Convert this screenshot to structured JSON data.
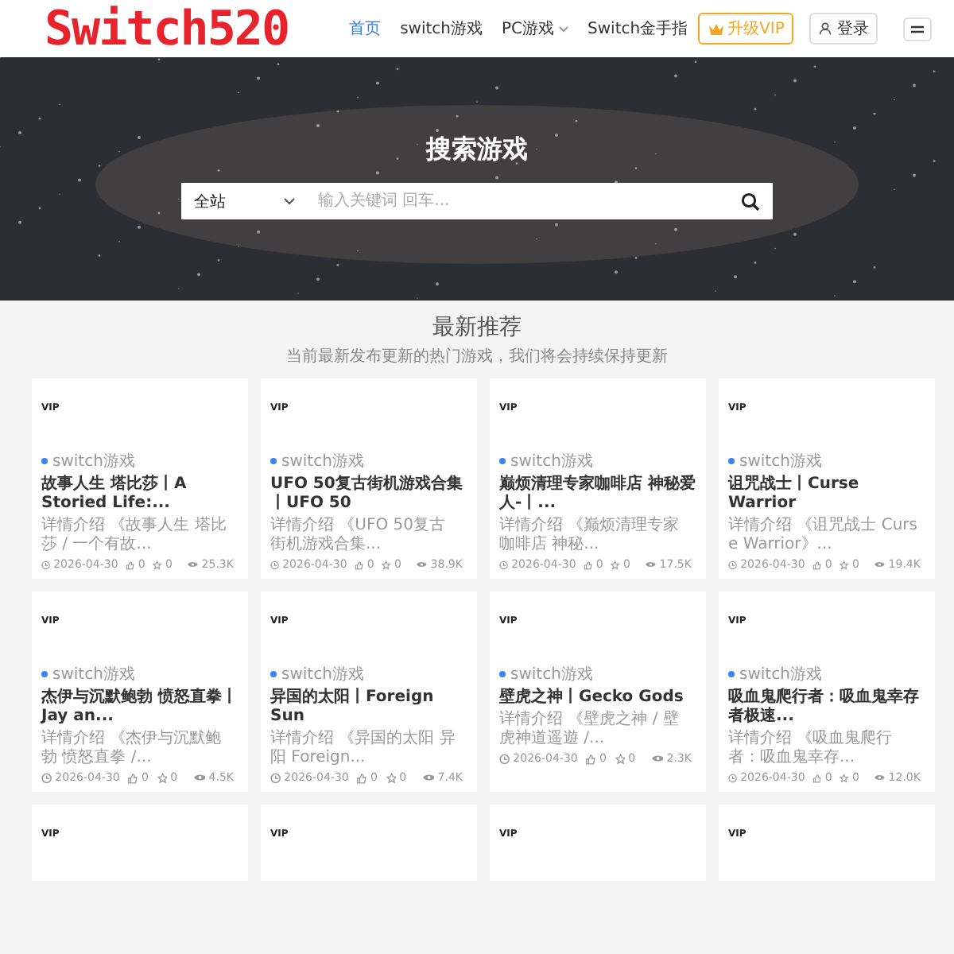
{
  "header": {
    "logo": "Switch520",
    "nav": [
      {
        "label": "首页",
        "selected": true,
        "dropdown": false
      },
      {
        "label": "switch游戏",
        "selected": false,
        "dropdown": false
      },
      {
        "label": "PC游戏",
        "selected": false,
        "dropdown": true
      },
      {
        "label": "Switch金手指",
        "selected": false,
        "dropdown": false
      }
    ],
    "vip_button": "升级VIP",
    "login_button": "登录"
  },
  "hero": {
    "title": "搜索游戏",
    "scope": "全站",
    "placeholder": "输入关键词 回车..."
  },
  "section": {
    "title": "最新推荐",
    "subtitle": "当前最新发布更新的热门游戏，我们将会持续保持更新"
  },
  "cards": [
    {
      "kind": "full",
      "badge": "VIP",
      "category": "switch游戏",
      "title": "故事人生 塔比莎丨A Storied Life:...",
      "description": "详情介绍 《故事人生 塔比莎 / 一个有故...",
      "date": "2026-04-30",
      "likes": "0",
      "favorites": "0",
      "views": "25.3K"
    },
    {
      "kind": "full",
      "badge": "VIP",
      "category": "switch游戏",
      "title": "UFO 50复古街机游戏合集丨UFO 50",
      "description": "详情介绍 《UFO 50复古街机游戏合集...",
      "date": "2026-04-30",
      "likes": "0",
      "favorites": "0",
      "views": "38.9K"
    },
    {
      "kind": "full",
      "badge": "VIP",
      "category": "switch游戏",
      "title": "巅烦清理专家咖啡店 神秘爱人-丨...",
      "description": "详情介绍 《巅烦清理专家咖啡店 神秘...",
      "date": "2026-04-30",
      "likes": "0",
      "favorites": "0",
      "views": "17.5K"
    },
    {
      "kind": "full",
      "badge": "VIP",
      "category": "switch游戏",
      "title": "诅咒战士丨Curse Warrior",
      "description": "详情介绍 《诅咒战士 Curse Warrior》...",
      "date": "2026-04-30",
      "likes": "0",
      "favorites": "0",
      "views": "19.4K"
    },
    {
      "kind": "full",
      "badge": "VIP",
      "category": "switch游戏",
      "title": "杰伊与沉默鲍勃 愤怒直拳丨Jay an...",
      "description": "详情介绍 《杰伊与沉默鲍勃 愤怒直拳 /...",
      "date": "2026-04-30",
      "likes": "0",
      "favorites": "0",
      "views": "4.5K"
    },
    {
      "kind": "full",
      "badge": "VIP",
      "category": "switch游戏",
      "title": "异国的太阳丨Foreign Sun",
      "description": "详情介绍 《异国的太阳 异阳 Foreign...",
      "date": "2026-04-30",
      "likes": "0",
      "favorites": "0",
      "views": "7.4K"
    },
    {
      "kind": "full",
      "badge": "VIP",
      "category": "switch游戏",
      "title": "壁虎之神丨Gecko Gods",
      "description": "详情介绍 《壁虎之神 / 壁虎神道遥遊 /...",
      "date": "2026-04-30",
      "likes": "0",
      "favorites": "0",
      "views": "2.3K"
    },
    {
      "kind": "full",
      "badge": "VIP",
      "category": "switch游戏",
      "title": "吸血鬼爬行者：吸血鬼幸存者极速...",
      "description": "详情介绍 《吸血鬼爬行者：吸血鬼幸存...",
      "date": "2026-04-30",
      "likes": "0",
      "favorites": "0",
      "views": "12.0K"
    },
    {
      "kind": "partial",
      "badge": "VIP"
    },
    {
      "kind": "partial",
      "badge": "VIP"
    },
    {
      "kind": "partial",
      "badge": "VIP"
    },
    {
      "kind": "partial",
      "badge": "VIP"
    }
  ]
}
